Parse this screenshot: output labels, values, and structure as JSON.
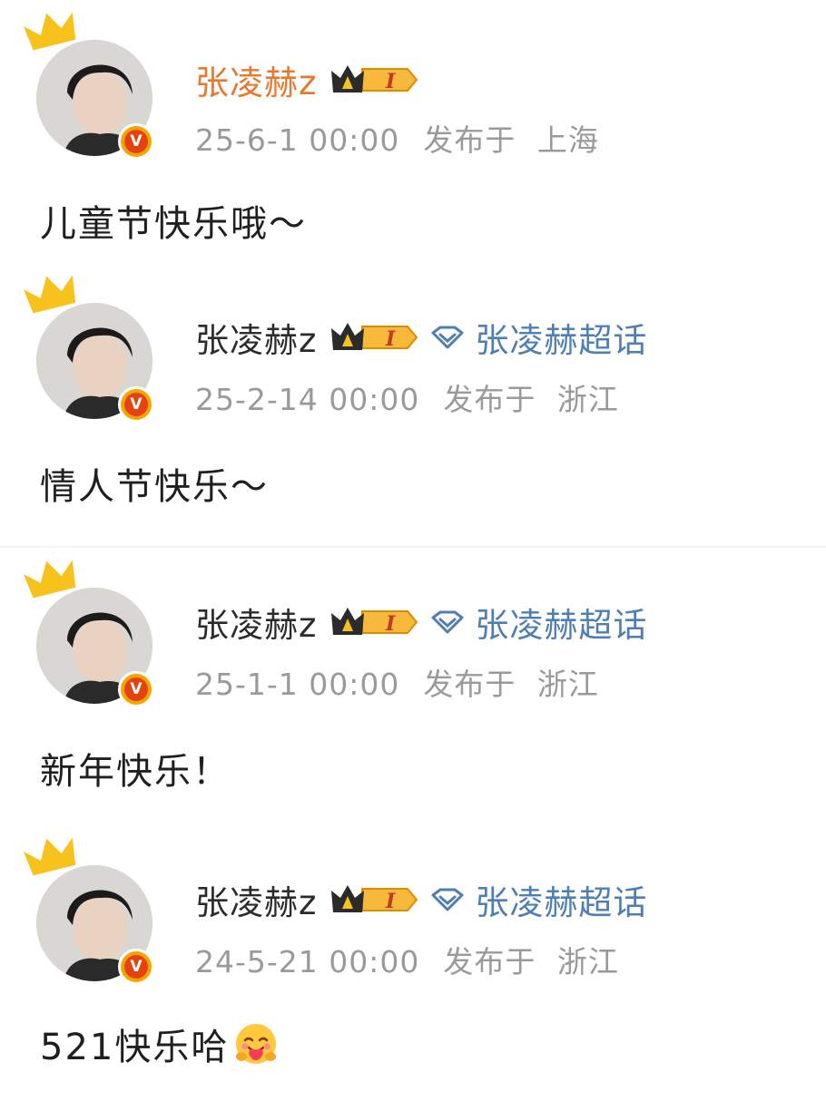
{
  "posts": [
    {
      "author": "张凌赫z",
      "has_topic": false,
      "date": "25-6-1 00:00",
      "location_prefix": "发布于",
      "location": "上海",
      "text": "儿童节快乐哦～"
    },
    {
      "author": "张凌赫z",
      "has_topic": true,
      "topic": "张凌赫超话",
      "date": "25-2-14 00:00",
      "location_prefix": "发布于",
      "location": "浙江",
      "text": "情人节快乐～"
    },
    {
      "author": "张凌赫z",
      "has_topic": true,
      "topic": "张凌赫超话",
      "date": "25-1-1 00:00",
      "location_prefix": "发布于",
      "location": "浙江",
      "text": "新年快乐！"
    },
    {
      "author": "张凌赫z",
      "has_topic": true,
      "topic": "张凌赫超话",
      "date": "24-5-21 00:00",
      "location_prefix": "发布于",
      "location": "浙江",
      "text": "521快乐哈",
      "emoji": "hug-emoji"
    }
  ],
  "icons": {
    "vip": "crown-vip-badge",
    "verified": "verified-v-badge",
    "avatar_crown": "crown-icon",
    "topic": "diamond-icon"
  },
  "colors": {
    "author_highlight": "#e8792c",
    "topic_link": "#4d7fb3",
    "meta_text": "#9a9a9a",
    "verified_orange": "#f5a400"
  }
}
